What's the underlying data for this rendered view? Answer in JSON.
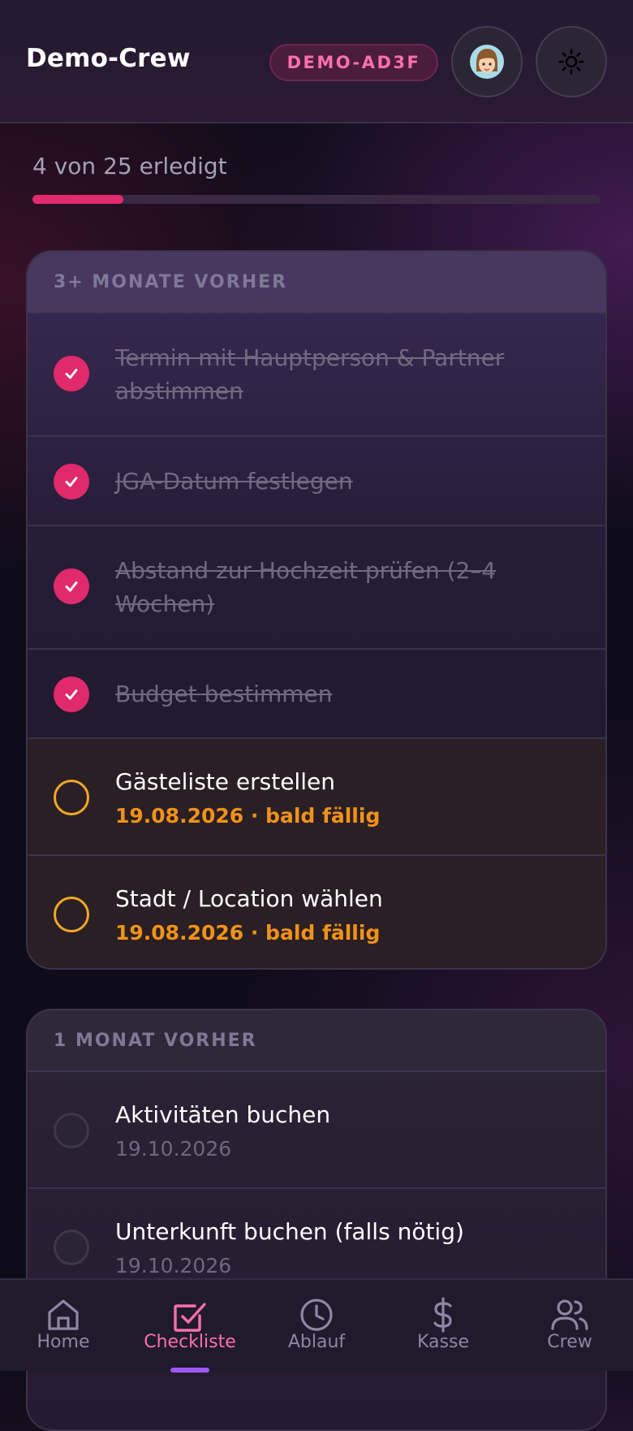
{
  "header": {
    "title": "Demo-Crew",
    "code": "DEMO-AD3F",
    "avatar_icon": "avatar-girl-icon",
    "theme_icon": "sun-icon"
  },
  "progress": {
    "text": "4 von 25 erledigt",
    "done": 4,
    "total": 25,
    "color": "#e22a6e"
  },
  "sections": [
    {
      "title": "3+ MONATE VORHER",
      "items": [
        {
          "title": "Termin mit Hauptperson & Partner abstimmen",
          "status": "done"
        },
        {
          "title": "JGA-Datum festlegen",
          "status": "done"
        },
        {
          "title": "Abstand zur Hochzeit prüfen (2–4 Wochen)",
          "status": "done"
        },
        {
          "title": "Budget bestimmen",
          "status": "done"
        },
        {
          "title": "Gästeliste erstellen",
          "status": "due-soon",
          "sub": "19.08.2026 · bald fällig"
        },
        {
          "title": "Stadt / Location wählen",
          "status": "due-soon",
          "sub": "19.08.2026 · bald fällig"
        }
      ]
    },
    {
      "title": "1 MONAT VORHER",
      "items": [
        {
          "title": "Aktivitäten buchen",
          "status": "open",
          "sub": "19.10.2026"
        },
        {
          "title": "Unterkunft buchen (falls nötig)",
          "status": "open",
          "sub": "19.10.2026"
        }
      ]
    }
  ],
  "nav": [
    {
      "label": "Home",
      "icon": "home-icon",
      "active": false
    },
    {
      "label": "Checkliste",
      "icon": "checkbox-icon",
      "active": true
    },
    {
      "label": "Ablauf",
      "icon": "clock-icon",
      "active": false
    },
    {
      "label": "Kasse",
      "icon": "dollar-icon",
      "active": false
    },
    {
      "label": "Crew",
      "icon": "users-icon",
      "active": false
    }
  ],
  "colors": {
    "accent": "#e22a6e",
    "warning": "#f0921a",
    "nav_active": "#ff6fae",
    "nav_indicator": "#9b59ff"
  }
}
